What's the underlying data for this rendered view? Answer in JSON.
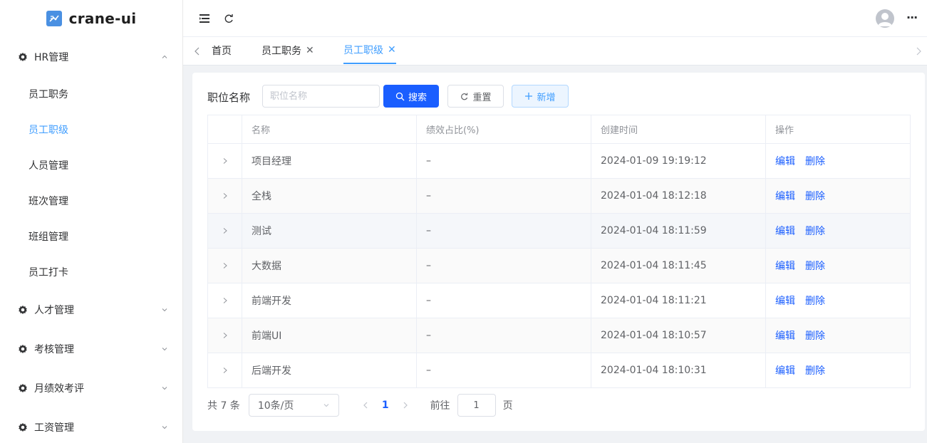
{
  "app": {
    "logo_text": "crane-ui"
  },
  "sidebar": {
    "groups": [
      {
        "label": "HR管理",
        "expanded": true,
        "items": [
          "员工职务",
          "员工职级",
          "人员管理",
          "班次管理",
          "班组管理",
          "员工打卡"
        ],
        "active_item": "员工职级"
      },
      {
        "label": "人才管理",
        "expanded": false
      },
      {
        "label": "考核管理",
        "expanded": false
      },
      {
        "label": "月绩效考评",
        "expanded": false
      },
      {
        "label": "工资管理",
        "expanded": false
      }
    ]
  },
  "header": {
    "icons": [
      "menu-fold-icon",
      "refresh-icon",
      "user-avatar-icon",
      "more-icon"
    ],
    "more_label": "···"
  },
  "tabs": {
    "items": [
      {
        "label": "首页",
        "closable": false,
        "active": false
      },
      {
        "label": "员工职务",
        "closable": true,
        "active": false
      },
      {
        "label": "员工职级",
        "closable": true,
        "active": true
      }
    ],
    "close_glyph": "✕"
  },
  "filter": {
    "label": "职位名称",
    "placeholder": "职位名称",
    "value": "",
    "search_label": "搜索",
    "reset_label": "重置",
    "add_label": "新增"
  },
  "table": {
    "columns": [
      "",
      "名称",
      "绩效占比(%)",
      "创建时间",
      "操作"
    ],
    "rows": [
      {
        "name": "项目经理",
        "ratio": "–",
        "created": "2024-01-09 19:19:12"
      },
      {
        "name": "全栈",
        "ratio": "–",
        "created": "2024-01-04 18:12:18"
      },
      {
        "name": "测试",
        "ratio": "–",
        "created": "2024-01-04 18:11:59"
      },
      {
        "name": "大数据",
        "ratio": "–",
        "created": "2024-01-04 18:11:45"
      },
      {
        "name": "前端开发",
        "ratio": "–",
        "created": "2024-01-04 18:11:21"
      },
      {
        "name": "前端UI",
        "ratio": "–",
        "created": "2024-01-04 18:10:57"
      },
      {
        "name": "后端开发",
        "ratio": "–",
        "created": "2024-01-04 18:10:31"
      }
    ],
    "action_edit": "编辑",
    "action_delete": "删除"
  },
  "pagination": {
    "total": "共 7 条",
    "page_size": "10条/页",
    "current_page": "1",
    "goto_label": "前往",
    "goto_value": "1",
    "page_suffix": "页"
  },
  "colors": {
    "primary": "#1a5eff",
    "accent": "#409eff",
    "sidebar_bg": "#ffffff",
    "page_bg": "#f0f2f5"
  }
}
